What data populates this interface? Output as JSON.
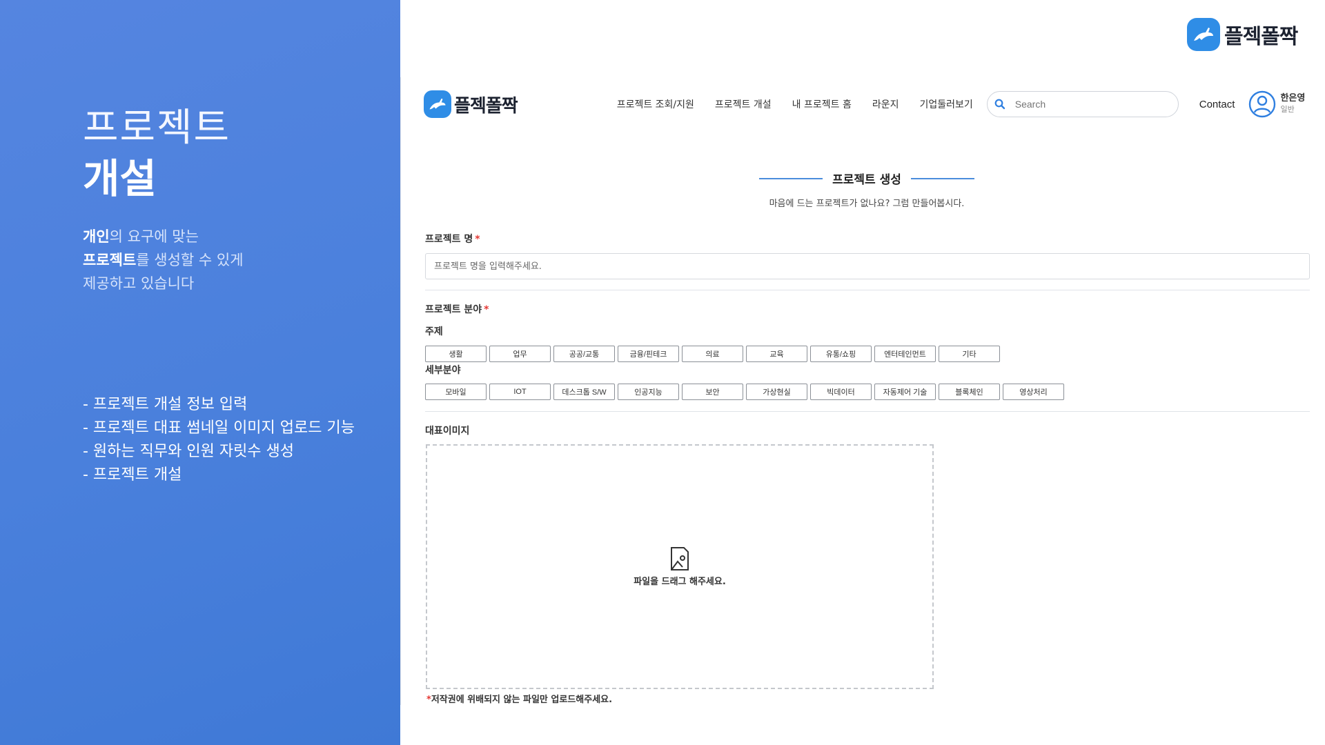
{
  "slide": {
    "title_line1": "프로젝트",
    "title_line2": "개설",
    "desc": {
      "l1_bold": "개인",
      "l1_rest": "의 요구에 맞는",
      "l2_bold": "프로젝트",
      "l2_rest": "를 생성할 수 있게",
      "l3": "제공하고 있습니다"
    },
    "features": [
      "- 프로젝트 개설 정보 입력",
      "- 프로젝트 대표 썸네일 이미지  업로드 기능",
      "- 원하는 직무와 인원 자릿수 생성",
      "- 프로젝트 개설"
    ],
    "brand": "플젝폴짝"
  },
  "app": {
    "brand": "플젝폴짝",
    "nav": [
      "프로젝트 조회/지원",
      "프로젝트 개설",
      "내 프로젝트 홈",
      "라운지",
      "기업둘러보기"
    ],
    "search_placeholder": "Search",
    "contact": "Contact",
    "user": {
      "name": "한은영",
      "role": "일반"
    }
  },
  "form": {
    "section_title": "프로젝트 생성",
    "section_sub": "마음에 드는 프로젝트가 없나요? 그럼 만들어봅시다.",
    "name_label": "프로젝트 명",
    "required_mark": "*",
    "name_placeholder": "프로젝트 명을 입력해주세요.",
    "field_label": "프로젝트 분야",
    "topic_label": "주제",
    "topics": [
      "생활",
      "업무",
      "공공/교통",
      "금융/핀테크",
      "의료",
      "교육",
      "유통/쇼핑",
      "엔터테인먼트",
      "기타"
    ],
    "subfield_label": "세부분야",
    "subfields": [
      "모바일",
      "IOT",
      "데스크톱 S/W",
      "인공지능",
      "보안",
      "가상현실",
      "빅데이터",
      "자동제어 기술",
      "블록체인",
      "영상처리"
    ],
    "image_label": "대표이미지",
    "drop_text": "파일을 드래그 해주세요.",
    "drop_note": "저작권에 위배되지 않는 파일만 업로드해주세요."
  },
  "colors": {
    "panel": "#4a80dc",
    "accent": "#4a8cdc",
    "logo": "#2f8de6",
    "required": "#e53935"
  },
  "icons": [
    "rabbit-logo-icon",
    "search-icon",
    "user-avatar-icon",
    "image-upload-icon"
  ]
}
